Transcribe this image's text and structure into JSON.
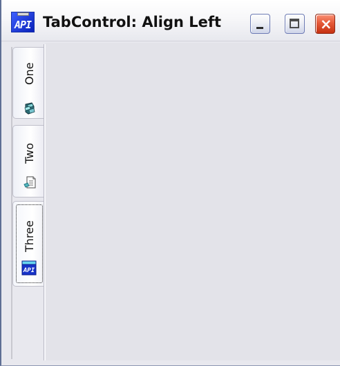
{
  "window": {
    "title": "TabControl: Align Left",
    "app_icon_text": "API",
    "controls": {
      "minimize_icon": "minimize-icon",
      "maximize_icon": "maximize-icon",
      "close_icon": "close-icon"
    }
  },
  "tabs": [
    {
      "label": "One",
      "icon": "monitor-stack-icon",
      "selected": false
    },
    {
      "label": "Two",
      "icon": "document-icon",
      "selected": false
    },
    {
      "label": "Three",
      "icon": "api-icon",
      "selected": true
    }
  ],
  "colors": {
    "window_frame": "#5f6f95",
    "client_background": "#e8e8ee",
    "close_button": "#e55a39",
    "api_blue": "#0921b8"
  }
}
